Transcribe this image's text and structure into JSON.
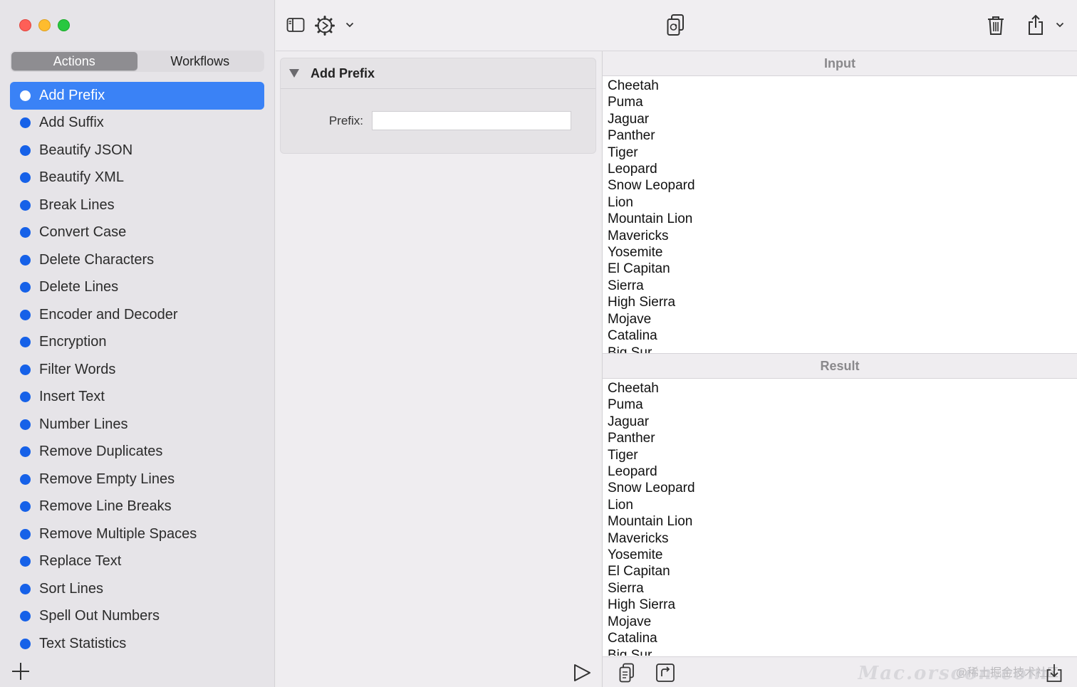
{
  "window": {
    "traffic_lights": [
      "close",
      "minimize",
      "maximize"
    ]
  },
  "sidebar": {
    "tabs": [
      {
        "label": "Actions",
        "active": true
      },
      {
        "label": "Workflows",
        "active": false
      }
    ],
    "actions": [
      {
        "label": "Add Prefix",
        "selected": true
      },
      {
        "label": "Add Suffix"
      },
      {
        "label": "Beautify JSON"
      },
      {
        "label": "Beautify XML"
      },
      {
        "label": "Break Lines"
      },
      {
        "label": "Convert Case"
      },
      {
        "label": "Delete Characters"
      },
      {
        "label": "Delete Lines"
      },
      {
        "label": "Encoder and Decoder"
      },
      {
        "label": "Encryption"
      },
      {
        "label": "Filter Words"
      },
      {
        "label": "Insert Text"
      },
      {
        "label": "Number Lines"
      },
      {
        "label": "Remove Duplicates"
      },
      {
        "label": "Remove Empty Lines"
      },
      {
        "label": "Remove Line Breaks"
      },
      {
        "label": "Remove Multiple Spaces"
      },
      {
        "label": "Replace Text"
      },
      {
        "label": "Sort Lines"
      },
      {
        "label": "Spell Out Numbers"
      },
      {
        "label": "Text Statistics"
      }
    ],
    "accent_color": "#3a82f6",
    "dot_color": "#1661e8"
  },
  "toolbar": {
    "icons": [
      "sidebar-toggle-icon",
      "gear-icon",
      "chevron-down-icon",
      "copy-swap-icon",
      "trash-icon",
      "share-icon",
      "chevron-down-icon"
    ]
  },
  "action_panel": {
    "title": "Add Prefix",
    "prefix_label": "Prefix:",
    "prefix_value": ""
  },
  "input": {
    "header": "Input",
    "lines": [
      "Cheetah",
      "Puma",
      "Jaguar",
      "Panther",
      "Tiger",
      "Leopard",
      "Snow Leopard",
      "Lion",
      "Mountain Lion",
      "Mavericks",
      "Yosemite",
      "El Capitan",
      "Sierra",
      "High Sierra",
      "Mojave",
      "Catalina",
      "Big Sur"
    ]
  },
  "result": {
    "header": "Result",
    "lines": [
      "Cheetah",
      "Puma",
      "Jaguar",
      "Panther",
      "Tiger",
      "Leopard",
      "Snow Leopard",
      "Lion",
      "Mountain Lion",
      "Mavericks",
      "Yosemite",
      "El Capitan",
      "Sierra",
      "High Sierra",
      "Mojave",
      "Catalina",
      "Big Sur"
    ]
  },
  "watermarks": {
    "cn": "@稀土掘金技术社区",
    "mac": "Mac.orsoon.com"
  }
}
